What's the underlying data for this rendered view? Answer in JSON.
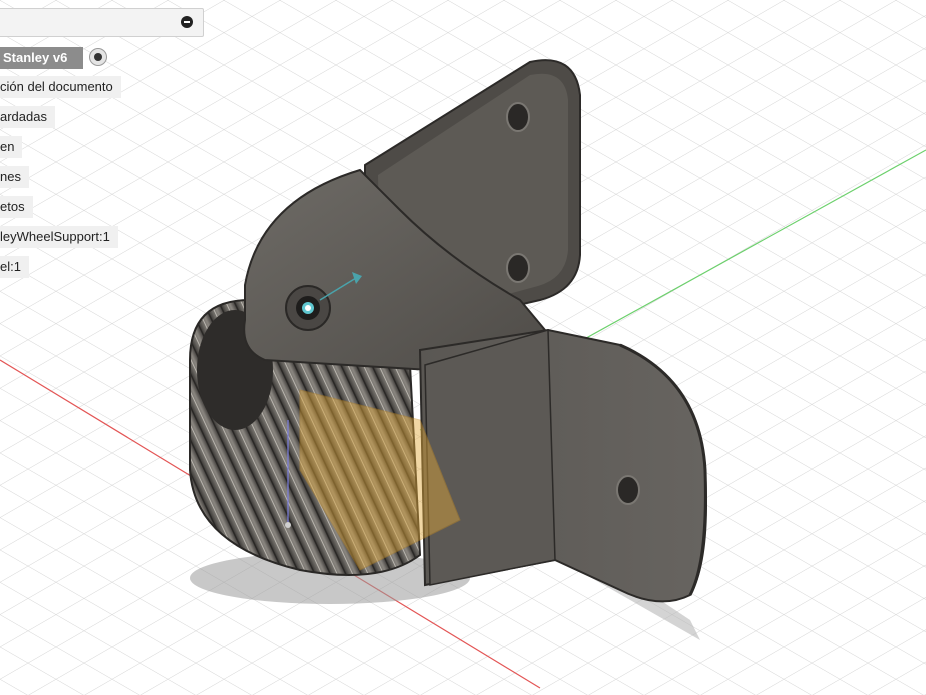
{
  "browser": {
    "root": {
      "label": "Stanley v6"
    },
    "items": [
      {
        "label": "ción del documento"
      },
      {
        "label": "ardadas"
      },
      {
        "label": "en"
      },
      {
        "label": "nes"
      },
      {
        "label": "etos"
      },
      {
        "label": "leyWheelSupport:1"
      },
      {
        "label": "el:1"
      }
    ]
  },
  "icons": {
    "collapse": "minus-circle-icon",
    "active": "radio-active-icon",
    "origin": "origin-point-icon"
  },
  "colors": {
    "model_body": "#5b5955",
    "model_edge": "#343230",
    "axis_x": "#e35555",
    "axis_y": "#6cd06c",
    "plane": "#e2a838",
    "grid": "#d4d4d4"
  }
}
